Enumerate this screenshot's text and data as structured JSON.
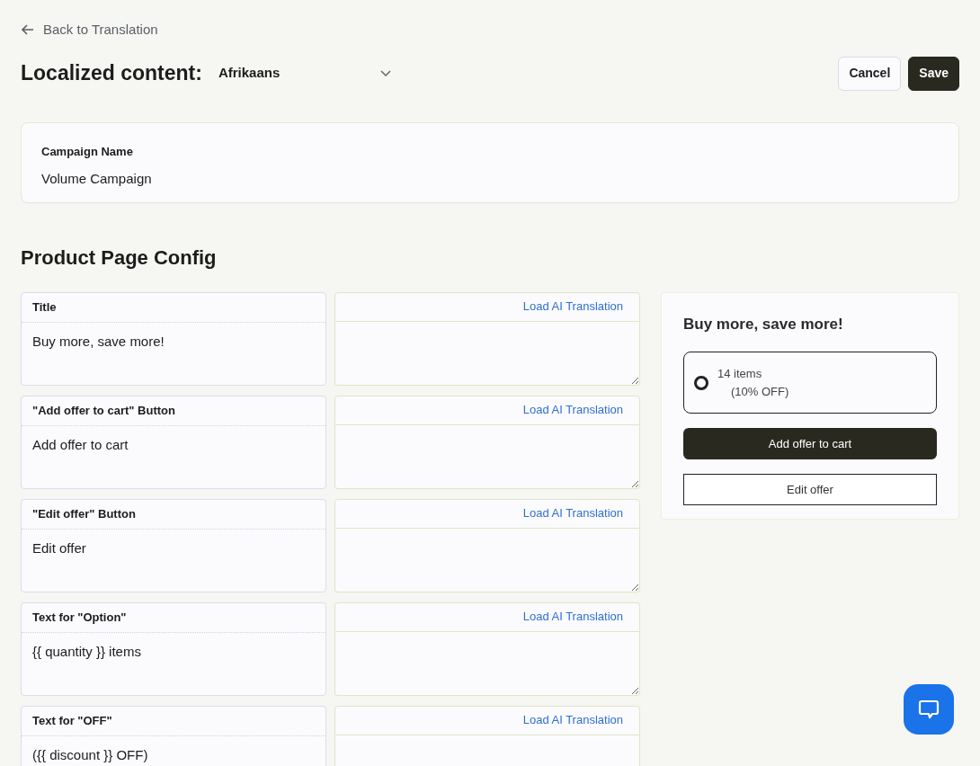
{
  "back_link": "Back to Translation",
  "header": {
    "title": "Localized content:",
    "language": "Afrikaans",
    "buttons": [
      {
        "label": "Cancel",
        "kind": "secondary"
      },
      {
        "label": "Save",
        "kind": "primary"
      }
    ]
  },
  "campaign": {
    "label": "Campaign Name",
    "value": "Volume Campaign"
  },
  "section_title": "Product Page Config",
  "fields": [
    {
      "label": "Title",
      "value": "Buy more, save more!",
      "action": "Load AI Translation"
    },
    {
      "label": "\"Add offer to cart\" Button",
      "value": "Add offer to cart",
      "action": "Load AI Translation"
    },
    {
      "label": "\"Edit offer\" Button",
      "value": "Edit offer",
      "action": "Load AI Translation"
    },
    {
      "label": "Text for \"Option\"",
      "value": "{{ quantity }} items",
      "action": "Load AI Translation"
    },
    {
      "label": "Text for \"OFF\"",
      "value": "({{ discount }} OFF)",
      "action": "Load AI Translation"
    }
  ],
  "preview": {
    "title": "Buy more, save more!",
    "option": {
      "quantity": "14 items",
      "discount": "(10% OFF)",
      "selected": true
    },
    "buttons": [
      {
        "label": "Add offer to cart",
        "kind": "primary"
      },
      {
        "label": "Edit offer",
        "kind": "outline"
      }
    ]
  }
}
